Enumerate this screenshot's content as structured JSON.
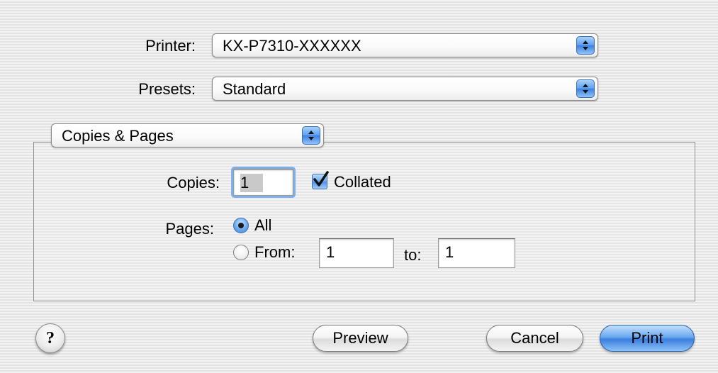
{
  "printer": {
    "label": "Printer:",
    "value": "KX-P7310-XXXXXX"
  },
  "presets": {
    "label": "Presets:",
    "value": "Standard"
  },
  "panel": {
    "value": "Copies & Pages"
  },
  "copies": {
    "label": "Copies:",
    "value": "1",
    "collated_label": "Collated",
    "collated_checked": true
  },
  "pages": {
    "label": "Pages:",
    "all_label": "All",
    "from_label": "From:",
    "from_value": "1",
    "to_label": "to:",
    "to_value": "1",
    "selected": "All"
  },
  "buttons": {
    "help": "?",
    "preview": "Preview",
    "cancel": "Cancel",
    "print": "Print"
  },
  "colors": {
    "accent": "#3b7fe0",
    "background": "#ececec"
  }
}
